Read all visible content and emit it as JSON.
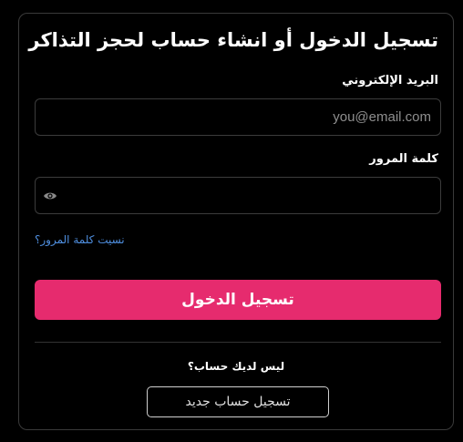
{
  "form": {
    "title": "تسجيل الدخول أو انشاء حساب لحجز التذاكر",
    "email_label": "البريد الإلكتروني",
    "email_placeholder": "you@email.com",
    "email_value": "",
    "password_label": "كلمة المرور",
    "password_value": "",
    "forgot_link": "نسيت كلمة المرور؟",
    "submit_label": "تسجيل الدخول",
    "no_account_text": "ليس لديك حساب؟",
    "register_label": "تسجيل حساب جديد"
  },
  "icons": {
    "password_toggle": "eye-icon"
  },
  "colors": {
    "background": "#000000",
    "primary": "#e62b6e",
    "link": "#4f8fe0",
    "border": "#3c3c3c"
  }
}
